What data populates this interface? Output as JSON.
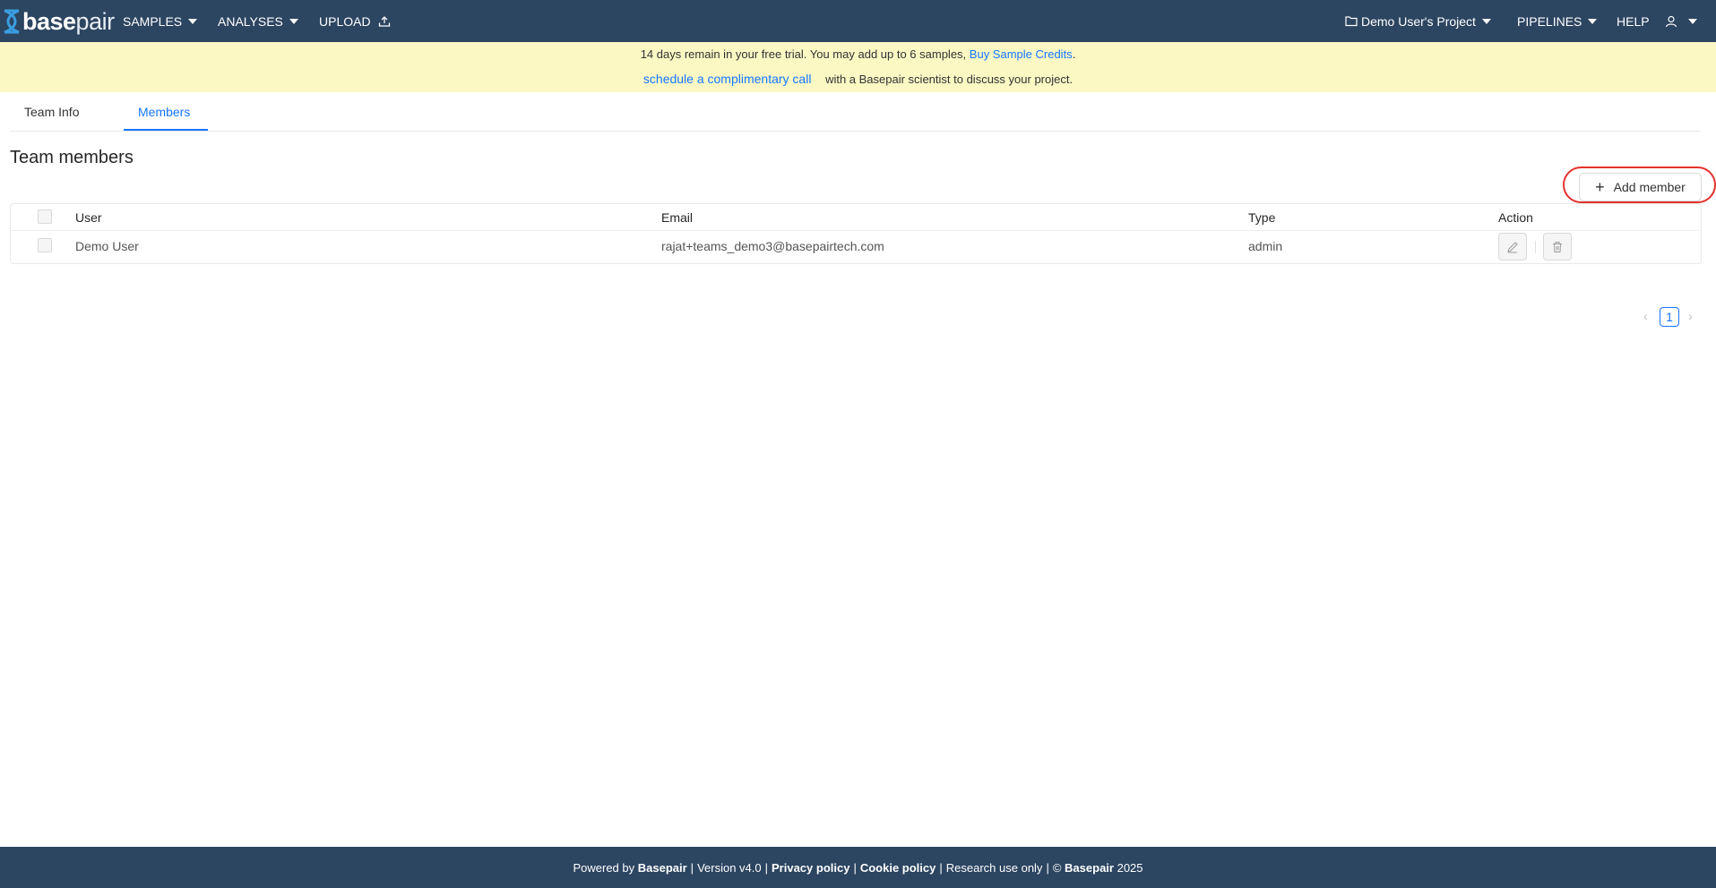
{
  "nav": {
    "logo_bold": "base",
    "logo_light": "pair",
    "samples": "SAMPLES",
    "analyses": "ANALYSES",
    "upload": "UPLOAD",
    "project": "Demo User's Project",
    "pipelines": "PIPELINES",
    "help": "HELP",
    "bg_color": "#2c4561"
  },
  "banner": {
    "line1_text": "14 days remain in your free trial. You may add up to 6 samples,",
    "buy_link": "Buy Sample Credits",
    "line1_end": ".",
    "call_link": "schedule a complimentary call",
    "line2_text": "with a Basepair scientist to discuss your project.",
    "bg_color": "#fbf8c4"
  },
  "tabs": [
    {
      "label": "Team Info",
      "active": false
    },
    {
      "label": "Members",
      "active": true
    }
  ],
  "section_title": "Team members",
  "add_member_label": "Add member",
  "table": {
    "columns": [
      "User",
      "Email",
      "Type",
      "Action"
    ],
    "rows": [
      {
        "user": "Demo User",
        "email": "rajat+teams_demo3@basepairtech.com",
        "type": "admin",
        "actions": [
          "edit-icon",
          "delete-icon"
        ]
      }
    ]
  },
  "pagination": {
    "current_page": "1"
  },
  "footer": {
    "powered_by": "Powered by",
    "brand": "Basepair",
    "version": "Version v4.0",
    "privacy": "Privacy policy",
    "cookie": "Cookie policy",
    "research": "Research use only",
    "copyright_symbol": "©",
    "year": "2025"
  },
  "accent_color": "#1677ff"
}
